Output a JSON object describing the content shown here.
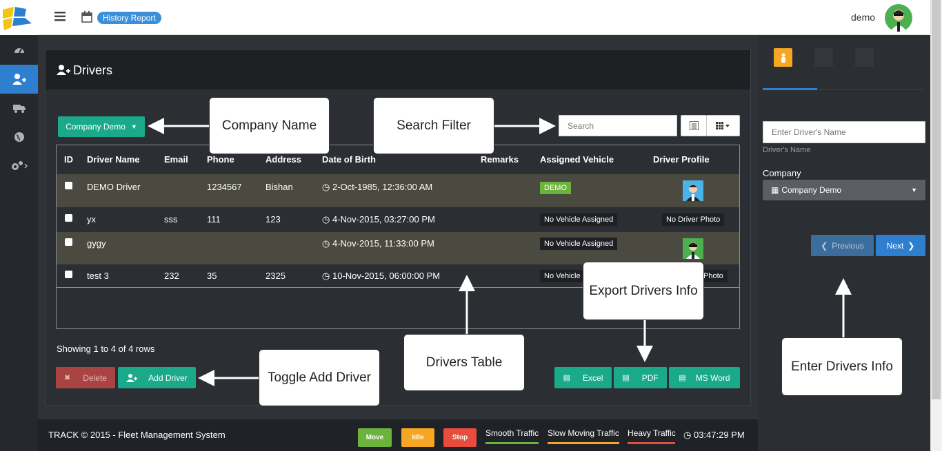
{
  "header": {
    "badge_label": "History Report",
    "username": "demo"
  },
  "panel": {
    "title": "Drivers",
    "company_dropdown": "Company Demo",
    "search_placeholder": "Search"
  },
  "table": {
    "columns": [
      "ID",
      "Driver Name",
      "Email",
      "Phone",
      "Address",
      "Date of Birth",
      "Remarks",
      "Assigned Vehicle",
      "Driver Profile"
    ],
    "rows": [
      {
        "name": "DEMO Driver",
        "email": "",
        "phone": "1234567",
        "address": "Bishan",
        "dob": "2-Oct-1985, 12:36:00 AM",
        "remarks": "",
        "vehicle": "DEMO",
        "profile": ""
      },
      {
        "name": "yx",
        "email": "sss",
        "phone": "111",
        "address": "123",
        "dob": "4-Nov-2015, 03:27:00 PM",
        "remarks": "",
        "vehicle": "No Vehicle Assigned",
        "profile": "No Driver Photo"
      },
      {
        "name": "gygy",
        "email": "",
        "phone": "",
        "address": "",
        "dob": "4-Nov-2015, 11:33:00 PM",
        "remarks": "",
        "vehicle": "No Vehicle Assigned",
        "profile": ""
      },
      {
        "name": "test 3",
        "email": "232",
        "phone": "35",
        "address": "2325",
        "dob": "10-Nov-2015, 06:00:00 PM",
        "remarks": "",
        "vehicle": "No Vehicle",
        "profile": "Photo"
      }
    ],
    "showing": "Showing 1 to 4 of 4 rows"
  },
  "actions": {
    "delete": "Delete",
    "add_driver": "Add Driver",
    "excel": "Excel",
    "pdf": "PDF",
    "msword": "MS Word"
  },
  "callouts": {
    "company_name": "Company Name",
    "search_filter": "Search Filter",
    "export": "Export Drivers Info",
    "drivers_table": "Drivers Table",
    "toggle_add": "Toggle Add Driver",
    "enter_info": "Enter Drivers Info"
  },
  "right_panel": {
    "name_placeholder": "Enter Driver's Name",
    "name_help": "Driver's Name",
    "company_label": "Company",
    "company_value": "Company Demo",
    "previous": "Previous",
    "next": "Next"
  },
  "footer": {
    "copyright": "TRACK © 2015 - Fleet Management System",
    "move": "Move",
    "idle": "Idle",
    "stop": "Stop",
    "smooth": "Smooth Traffic",
    "slow": "Slow Moving Traffic",
    "heavy": "Heavy Traffic",
    "time": "03:47:29 PM"
  },
  "colors": {
    "teal": "#1aaa8a",
    "blue": "#2f7fd0",
    "red": "#c0392b",
    "green": "#6cb33e",
    "orange": "#f5a623"
  }
}
